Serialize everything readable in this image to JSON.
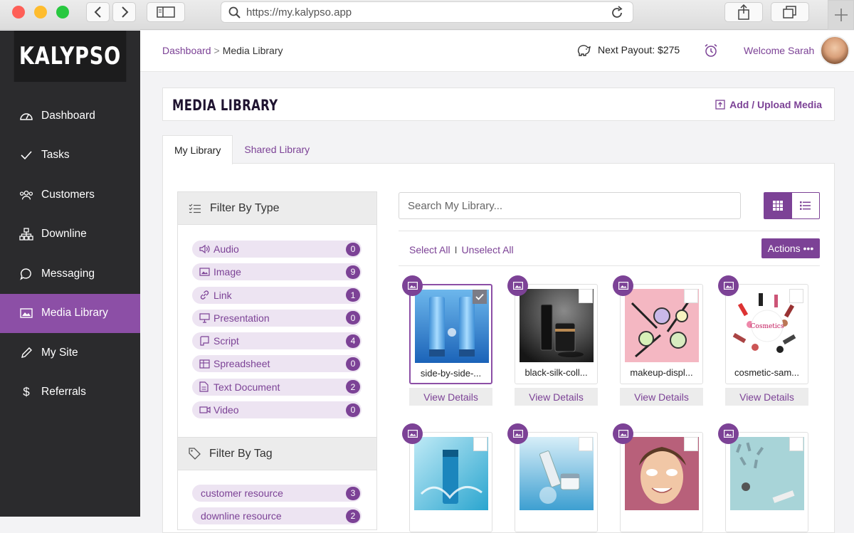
{
  "browser": {
    "url": "https://my.kalypso.app"
  },
  "brand": {
    "logo_text": "KALYPSO"
  },
  "sidebar": {
    "items": [
      {
        "label": "Dashboard",
        "icon": "gauge-icon"
      },
      {
        "label": "Tasks",
        "icon": "check-icon"
      },
      {
        "label": "Customers",
        "icon": "users-icon"
      },
      {
        "label": "Downline",
        "icon": "hierarchy-icon"
      },
      {
        "label": "Messaging",
        "icon": "chat-icon"
      },
      {
        "label": "Media Library",
        "icon": "image-icon",
        "active": true
      },
      {
        "label": "My Site",
        "icon": "pencil-icon"
      },
      {
        "label": "Referrals",
        "icon": "dollar-icon"
      }
    ]
  },
  "header": {
    "breadcrumb_link": "Dashboard",
    "breadcrumb_sep": ">",
    "breadcrumb_current": "Media Library",
    "payout": "Next Payout: $275",
    "welcome": "Welcome Sarah"
  },
  "page": {
    "title": "MEDIA LIBRARY",
    "upload_label": "Add / Upload Media"
  },
  "tabs": [
    {
      "label": "My Library",
      "active": true
    },
    {
      "label": "Shared Library",
      "active": false
    }
  ],
  "filter_type": {
    "heading": "Filter By Type",
    "items": [
      {
        "label": "Audio",
        "count": "0",
        "icon": "speaker-icon"
      },
      {
        "label": "Image",
        "count": "9",
        "icon": "image-icon"
      },
      {
        "label": "Link",
        "count": "1",
        "icon": "link-icon"
      },
      {
        "label": "Presentation",
        "count": "0",
        "icon": "presentation-icon"
      },
      {
        "label": "Script",
        "count": "4",
        "icon": "script-icon"
      },
      {
        "label": "Spreadsheet",
        "count": "0",
        "icon": "spreadsheet-icon"
      },
      {
        "label": "Text Document",
        "count": "2",
        "icon": "document-icon"
      },
      {
        "label": "Video",
        "count": "0",
        "icon": "video-icon"
      }
    ]
  },
  "filter_tag": {
    "heading": "Filter By Tag",
    "items": [
      {
        "label": "customer resource",
        "count": "3"
      },
      {
        "label": "downline resource",
        "count": "2"
      }
    ]
  },
  "search": {
    "placeholder": "Search My Library..."
  },
  "selection": {
    "select_all": "Select All",
    "separator": "I",
    "unselect_all": "Unselect All"
  },
  "actions_label": "Actions •••",
  "details_label": "View Details",
  "media": [
    {
      "name": "side-by-side-...",
      "selected": true
    },
    {
      "name": "black-silk-coll...",
      "selected": false
    },
    {
      "name": "makeup-displ...",
      "selected": false
    },
    {
      "name": "cosmetic-sam...",
      "selected": false
    },
    {
      "name": "",
      "selected": false
    },
    {
      "name": "",
      "selected": false
    },
    {
      "name": "",
      "selected": false
    },
    {
      "name": "",
      "selected": false
    }
  ],
  "colors": {
    "accent": "#7c4296",
    "sidebar": "#2b2b2d",
    "active_nav": "#8c4fa6"
  }
}
